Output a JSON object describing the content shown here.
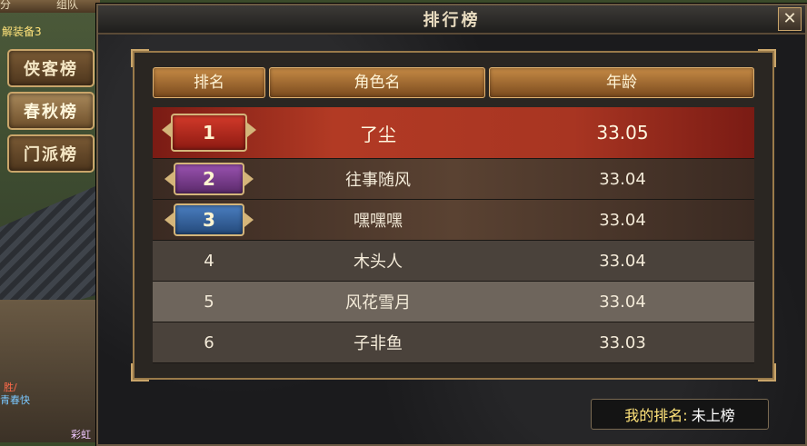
{
  "background": {
    "top_tabs": [
      "分",
      "组队"
    ],
    "left_caption": "解装备3",
    "categories": [
      {
        "label": "侠客榜",
        "active": false
      },
      {
        "label": "春秋榜",
        "active": true
      },
      {
        "label": "门派榜",
        "active": false
      }
    ],
    "side_text": [
      "胜/",
      "青春快",
      "彩虹"
    ]
  },
  "window": {
    "title": "排行榜",
    "close_symbol": "✕"
  },
  "table": {
    "headers": {
      "rank": "排名",
      "name": "角色名",
      "age": "年龄"
    },
    "rows": [
      {
        "rank": "1",
        "name": "了尘",
        "age": "33.05"
      },
      {
        "rank": "2",
        "name": "往事随风",
        "age": "33.04"
      },
      {
        "rank": "3",
        "name": "嘿嘿嘿",
        "age": "33.04"
      },
      {
        "rank": "4",
        "name": "木头人",
        "age": "33.04"
      },
      {
        "rank": "5",
        "name": "风花雪月",
        "age": "33.04"
      },
      {
        "rank": "6",
        "name": "子非鱼",
        "age": "33.03"
      }
    ]
  },
  "my_rank": {
    "label": "我的排名:",
    "value": "未上榜"
  },
  "colors": {
    "gold_medal": "#d33a2a",
    "silver_medal": "#9a52b0",
    "bronze_medal": "#4a7ec0",
    "header_bg": "#c58a45",
    "my_rank_label": "#ffe37a"
  }
}
